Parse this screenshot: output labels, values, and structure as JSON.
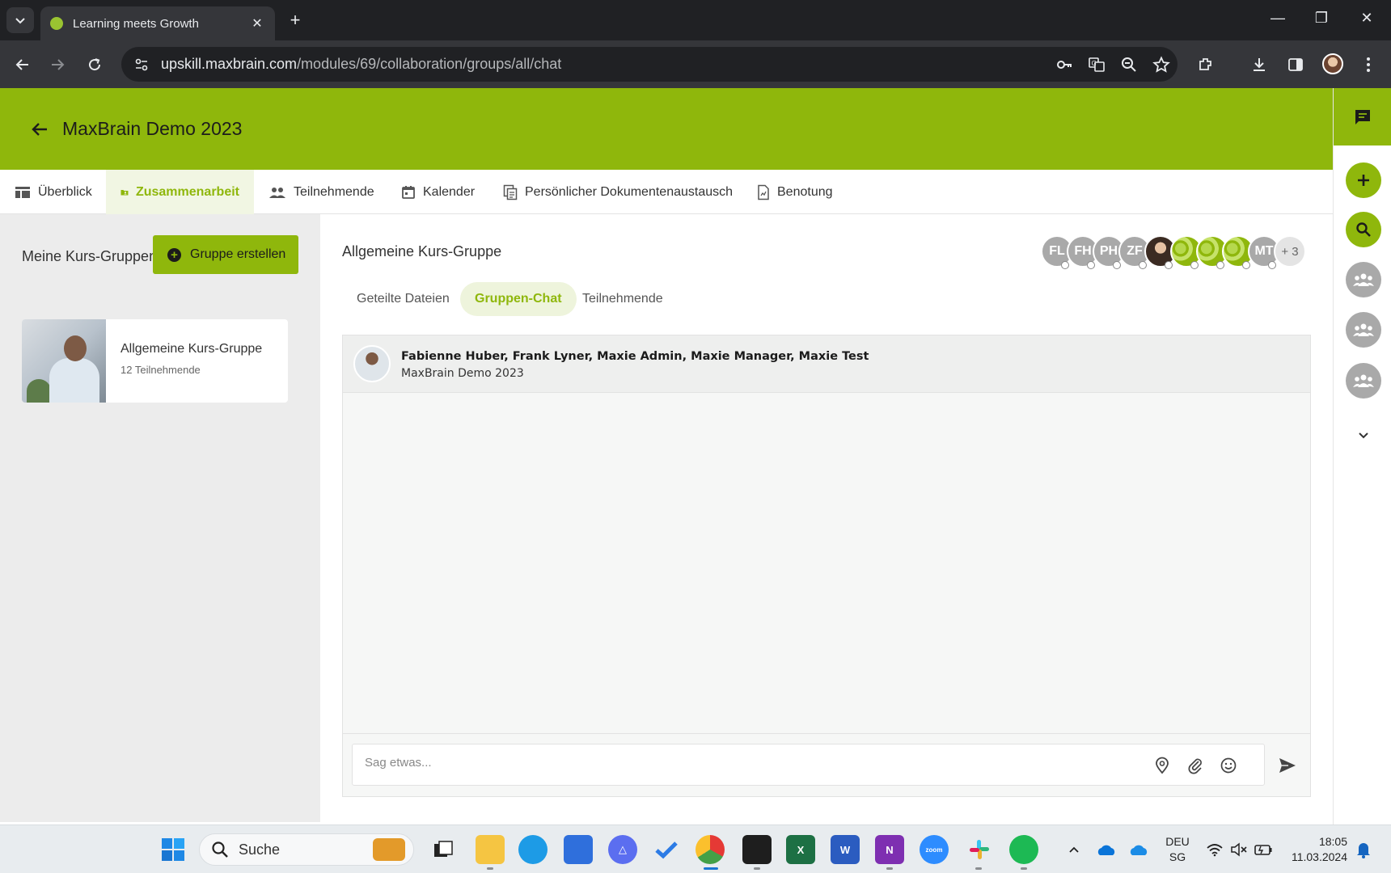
{
  "browser": {
    "tab_title": "Learning meets Growth",
    "url_host": "upskill.maxbrain.com",
    "url_path": "/modules/69/collaboration/groups/all/chat"
  },
  "app": {
    "title": "MaxBrain Demo 2023",
    "accent_color": "#8fb70c",
    "nav_tabs": [
      {
        "label": "Überblick",
        "icon": "dashboard-icon"
      },
      {
        "label": "Zusammenarbeit",
        "icon": "folder-shared-icon",
        "active": true
      },
      {
        "label": "Teilnehmende",
        "icon": "people-icon"
      },
      {
        "label": "Kalender",
        "icon": "calendar-icon"
      },
      {
        "label": "Persönlicher Dokumentenaustausch",
        "icon": "documents-icon"
      },
      {
        "label": "Benotung",
        "icon": "grading-icon"
      }
    ]
  },
  "left_panel": {
    "title": "Meine Kurs-Gruppen",
    "create_button": "Gruppe erstellen",
    "groups": [
      {
        "name": "Allgemeine Kurs-Gruppe",
        "count": "12 Teilnehmende"
      }
    ]
  },
  "main": {
    "group_title": "Allgemeine Kurs-Gruppe",
    "avatars": [
      "FL",
      "FH",
      "PH",
      "ZF",
      "",
      "",
      "",
      "",
      "MT"
    ],
    "more_count": "+ 3",
    "sub_tabs": [
      {
        "label": "Geteilte Dateien"
      },
      {
        "label": "Gruppen-Chat",
        "active": true
      },
      {
        "label": "Teilnehmende"
      }
    ],
    "chat": {
      "members": "Fabienne Huber, Frank Lyner, Maxie Admin, Maxie Manager, Maxie Test",
      "course": "MaxBrain Demo 2023",
      "input_placeholder": "Sag etwas..."
    }
  },
  "taskbar": {
    "search_label": "Suche",
    "language": "DEU",
    "region": "SG",
    "time": "18:05",
    "date": "11.03.2024"
  }
}
